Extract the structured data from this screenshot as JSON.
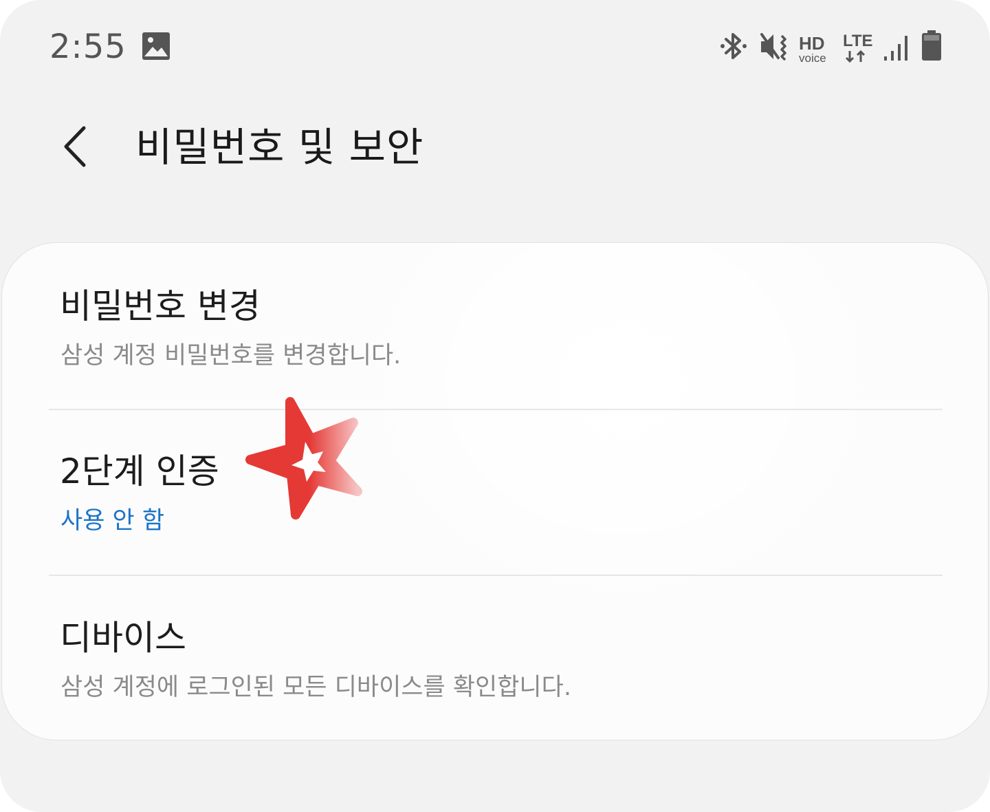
{
  "status_bar": {
    "time": "2:55",
    "icons": [
      "gallery-icon",
      "bluetooth-icon",
      "vibrate-icon",
      "hd-voice-icon",
      "lte-icon",
      "signal-icon",
      "battery-icon"
    ],
    "hd_label": "HD",
    "hd_sublabel": "voice",
    "lte_label": "LTE"
  },
  "header": {
    "back_icon": "chevron-left-icon",
    "title": "비밀번호 및 보안"
  },
  "settings": {
    "items": [
      {
        "title": "비밀번호 변경",
        "subtitle": "삼성 계정 비밀번호를 변경합니다."
      },
      {
        "title": "2단계 인증",
        "subtitle": "사용 안 함"
      },
      {
        "title": "디바이스",
        "subtitle": "삼성 계정에 로그인된 모든 디바이스를 확인합니다."
      }
    ]
  },
  "colors": {
    "background": "#f2f2f2",
    "card": "#fcfcfc",
    "accent": "#1a73c8",
    "title_text": "#1c1c1c",
    "subtitle_text": "#8a8a8a",
    "star": "#e53935"
  }
}
